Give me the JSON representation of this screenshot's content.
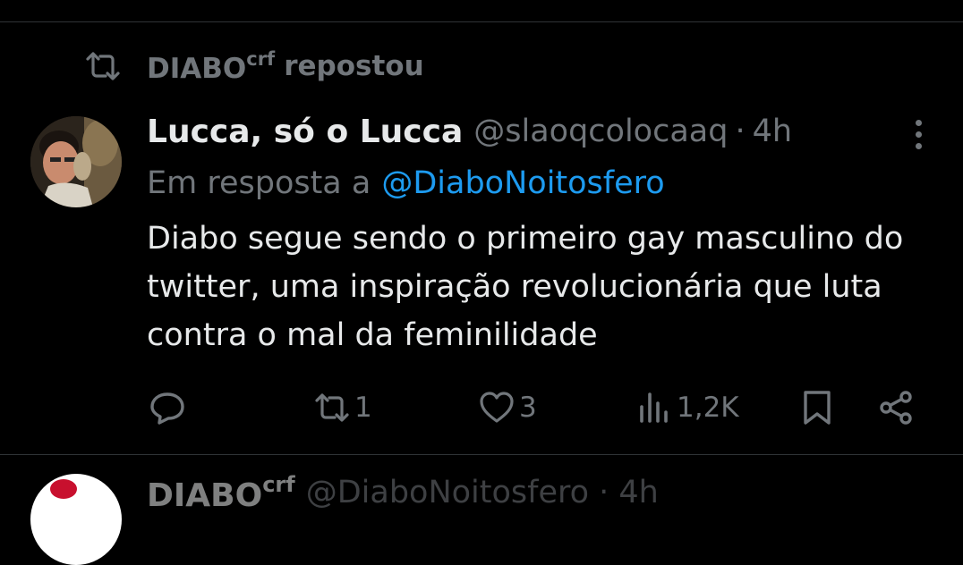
{
  "repost": {
    "name": "DIABO",
    "name_sup": "crf",
    "suffix": "repostou",
    "icon": "repost-icon"
  },
  "tweet": {
    "display_name": "Lucca, só o Lucca",
    "handle": "@slaoqcolocaaq",
    "separator": "·",
    "time": "4h",
    "reply_prefix": "Em resposta a",
    "reply_to": "@DiaboNoitosfero",
    "text": "Diabo segue sendo o primeiro gay masculino do twitter, uma inspiração revolucionária que luta contra o mal da feminilidade",
    "avatar_icon": "user-avatar",
    "more_icon": "more-vertical-icon"
  },
  "actions": {
    "reply": {
      "icon": "reply-icon",
      "count": ""
    },
    "repost": {
      "icon": "repost-icon",
      "count": "1"
    },
    "like": {
      "icon": "heart-icon",
      "count": "3"
    },
    "views": {
      "icon": "views-chart-icon",
      "count": "1,2K"
    },
    "bookmark": {
      "icon": "bookmark-icon"
    },
    "share": {
      "icon": "share-icon"
    }
  },
  "next_tweet": {
    "display_name": "DIABO",
    "name_sup": "crf",
    "handle": "@DiaboNoitosfero · 4h"
  },
  "colors": {
    "background": "#000000",
    "text_primary": "#e7e9ea",
    "text_secondary": "#71767b",
    "accent_link": "#1d9bf0",
    "divider": "#2f3336"
  }
}
